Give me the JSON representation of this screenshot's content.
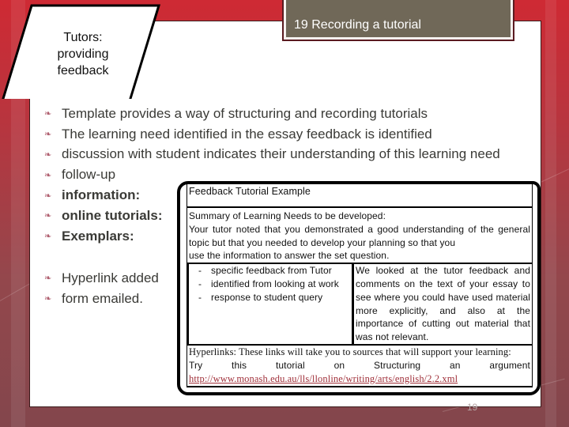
{
  "section_tag": {
    "lines": [
      "Tutors:",
      "providing",
      "feedback"
    ]
  },
  "title": "19 Recording a tutorial",
  "bullets_top": [
    {
      "text": "Template provides a way of structuring and recording tutorials",
      "bold": false
    },
    {
      "text": "The learning need identified in the essay feedback is identified",
      "bold": false
    },
    {
      "text": "discussion with student indicates their understanding of this learning need",
      "bold": false
    },
    {
      "text": "follow-up",
      "bold": false
    },
    {
      "text": "information:",
      "bold": true
    },
    {
      "text": "online tutorials:",
      "bold": true
    },
    {
      "text": "Exemplars:",
      "bold": true
    }
  ],
  "bullets_bottom": [
    {
      "text": "Hyperlink added"
    },
    {
      "text": "form emailed."
    }
  ],
  "bullet_icon": "fleuron-bullet-icon",
  "feedback_form": {
    "heading": "Feedback Tutorial  Example",
    "summary_label": "Summary of Learning Needs to be developed:",
    "summary_text": "Your tutor noted that you demonstrated a good understanding of the general topic but that you needed to develop your planning so that you",
    "summary_last": "use the information to answer the set question.",
    "sources": [
      {
        "dash": "-",
        "text": "specific feedback from Tutor"
      },
      {
        "dash": "-",
        "text": "identified from looking at work"
      },
      {
        "dash": "-",
        "text": "response to student query"
      }
    ],
    "response": "We looked at the tutor feedback and comments on the text of your essay to see where you could have used material more explicitly, and also at the importance of cutting out material that was not relevant.",
    "hyperlinks_label": "Hyperlinks: These links will take you to sources that will support your learning:",
    "try_words": [
      "Try",
      "this",
      "tutorial",
      "on",
      "Structuring",
      "an",
      "argument"
    ],
    "url": "http://www.monash.edu.au/lls/llonline/writing/arts/english/2.2.xml"
  },
  "page_number": "19",
  "colors": {
    "title_fill": "#706858",
    "bullet": "#b06070",
    "link": "#a0303a",
    "background": "#c8283a"
  }
}
